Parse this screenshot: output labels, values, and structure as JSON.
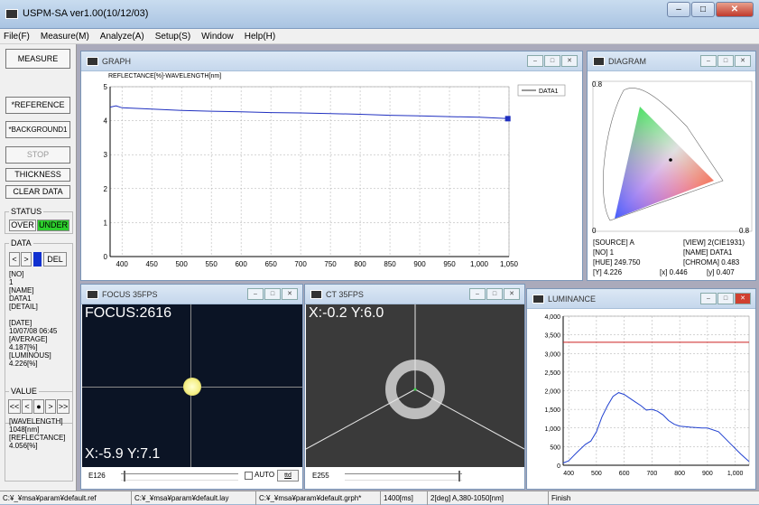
{
  "window": {
    "title": "USPM-SA ver1.00(10/12/03)"
  },
  "menu": [
    "File(F)",
    "Measure(M)",
    "Analyze(A)",
    "Setup(S)",
    "Window",
    "Help(H)"
  ],
  "left": {
    "measure": "MEASURE",
    "reference": "*REFERENCE",
    "background": "*BACKGROUND1",
    "stop": "STOP",
    "thickness": "THICKNESS",
    "clear": "CLEAR DATA",
    "status_label": "STATUS",
    "over": "OVER",
    "under": "UNDER",
    "data_label": "DATA",
    "prev": "<",
    "next": ">",
    "del": "DEL",
    "lines": [
      "[NO]",
      "1",
      "[NAME]",
      "DATA1",
      "[DETAIL]",
      "",
      "[DATE]",
      "10/07/08 06:45",
      "[AVERAGE]",
      "4.187[%]",
      "[LUMINOUS]",
      "4.226[%]"
    ],
    "value_label": "VALUE",
    "nav": [
      "<<",
      "<",
      "●",
      ">",
      ">>"
    ],
    "value_lines": [
      "[WAVELENGTH]",
      "1048[nm]",
      "[REFLECTANCE]",
      "4.056[%]"
    ]
  },
  "colors": {
    "under_bg": "#2dcf2d",
    "graph_line": "#2030c0",
    "lum_line": "#2040d0",
    "lum_ref": "#cc2020",
    "spot": "#f5f08a"
  },
  "graph": {
    "title": "GRAPH"
  },
  "diagram": {
    "title": "DIAGRAM",
    "y_top": "0.8",
    "x_zero": "0",
    "x_right": "0.8",
    "info": {
      "source": "[SOURCE] A",
      "view": "[VIEW] 2(CIE1931)",
      "no": "[NO] 1",
      "name": "[NAME] DATA1",
      "hue": "[HUE] 249.750",
      "chroma": "[CHROMA] 0.483",
      "Y": "[Y] 4.226",
      "x": "[x] 0.446",
      "y": "[y] 0.407"
    }
  },
  "focus": {
    "title": "FOCUS 35FPS",
    "readout": "FOCUS:2616",
    "xy": "X:-5.9 Y:7.1",
    "e_label": "E126",
    "auto": "AUTO",
    "auto_btn": "ttd"
  },
  "ct": {
    "title": "CT 35FPS",
    "xy": "X:-0.2 Y:6.0",
    "e_label": "E255"
  },
  "luminance": {
    "title": "LUMINANCE"
  },
  "status_bar": [
    "C:¥_¥msa¥param¥default.ref",
    "C:¥_¥msa¥param¥default.lay",
    "C:¥_¥msa¥param¥default.grph*",
    "1400[ms]",
    "2[deg] A,380-1050[nm]",
    "Finish"
  ],
  "chart_data": [
    {
      "type": "line",
      "title": "REFLECTANCE[%]-WAVELENGTH[nm]",
      "xticks": [
        "400",
        "450",
        "500",
        "550",
        "600",
        "650",
        "700",
        "750",
        "800",
        "850",
        "900",
        "950",
        "1,000",
        "1,050"
      ],
      "yticks": [
        "0",
        "1",
        "2",
        "3",
        "4",
        "5"
      ],
      "xlim": [
        380,
        1050
      ],
      "ylim": [
        0,
        5
      ],
      "grid": true,
      "legend": "top-right",
      "series": [
        {
          "name": "DATA1",
          "x": [
            380,
            390,
            400,
            450,
            500,
            550,
            600,
            650,
            700,
            750,
            800,
            850,
            900,
            950,
            1000,
            1048
          ],
          "y": [
            4.4,
            4.44,
            4.38,
            4.34,
            4.3,
            4.28,
            4.26,
            4.24,
            4.23,
            4.21,
            4.19,
            4.16,
            4.14,
            4.12,
            4.1,
            4.06
          ]
        }
      ]
    },
    {
      "type": "line",
      "title": "",
      "xticks": [
        "400",
        "500",
        "600",
        "700",
        "800",
        "900",
        "1,000"
      ],
      "yticks": [
        "0",
        "500",
        "1,000",
        "1,500",
        "2,000",
        "2,500",
        "3,000",
        "3,500",
        "4,000"
      ],
      "xlim": [
        380,
        1050
      ],
      "ylim": [
        0,
        4000
      ],
      "grid": true,
      "series": [
        {
          "x": [
            380,
            400,
            430,
            460,
            480,
            500,
            520,
            540,
            560,
            580,
            600,
            620,
            640,
            660,
            680,
            700,
            720,
            740,
            760,
            780,
            800,
            840,
            880,
            900,
            940,
            980,
            1020,
            1050
          ],
          "y": [
            60,
            120,
            350,
            560,
            650,
            900,
            1300,
            1600,
            1850,
            1950,
            1900,
            1800,
            1700,
            1600,
            1480,
            1500,
            1450,
            1350,
            1200,
            1100,
            1050,
            1020,
            1000,
            1000,
            900,
            600,
            300,
            100
          ]
        }
      ],
      "reference_line": 3300
    }
  ]
}
